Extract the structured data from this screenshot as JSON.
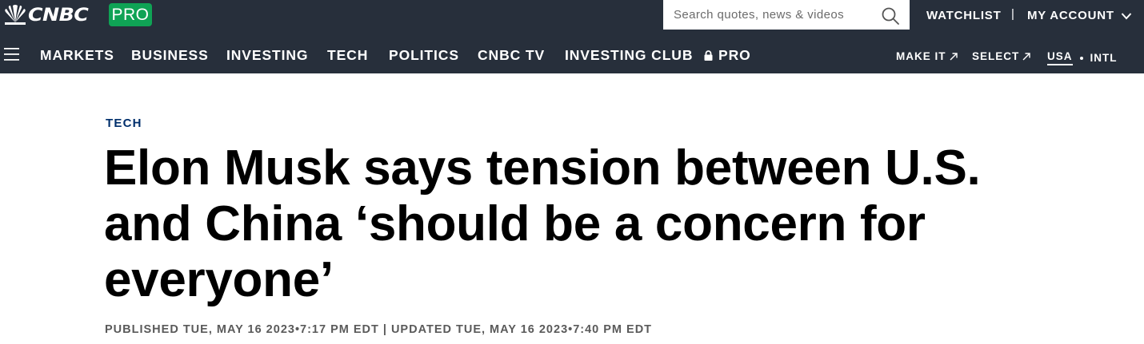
{
  "header": {
    "logo_text": "CNBC",
    "pro_badge": "PRO",
    "search_placeholder": "Search quotes, news & videos",
    "watchlist": "WATCHLIST",
    "separator": "|",
    "my_account": "MY ACCOUNT"
  },
  "nav": {
    "items": [
      "MARKETS",
      "BUSINESS",
      "INVESTING",
      "TECH",
      "POLITICS",
      "CNBC TV",
      "INVESTING CLUB",
      "PRO"
    ],
    "util": {
      "make_it": "MAKE IT",
      "select": "SELECT",
      "usa": "USA",
      "intl": "INTL"
    }
  },
  "article": {
    "section": "TECH",
    "headline": "Elon Musk says tension between U.S. and China ‘should be a concern for everyone’",
    "byline": "PUBLISHED TUE, MAY 16 2023•7:17 PM EDT | UPDATED TUE, MAY 16 2023•7:40 PM EDT"
  },
  "colors": {
    "header_bg": "#272f3b",
    "pro_green": "#0fa355",
    "section_blue": "#002f6c",
    "byline_gray": "#5a5a5a"
  },
  "icons": [
    "peacock-logo-icon",
    "search-icon",
    "chevron-down-icon",
    "hamburger-menu-icon",
    "lock-icon",
    "external-arrow-icon"
  ]
}
